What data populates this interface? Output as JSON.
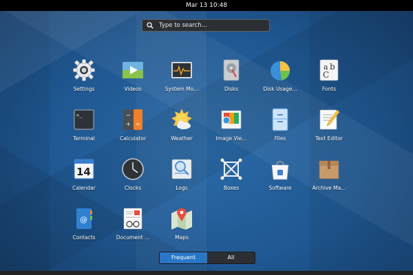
{
  "topbar": {
    "datetime": "Mar 13  10:48"
  },
  "search": {
    "placeholder": "Type to search..."
  },
  "apps": [
    {
      "label": "Settings",
      "icon": "settings-icon"
    },
    {
      "label": "Videos",
      "icon": "videos-icon"
    },
    {
      "label": "System Mo...",
      "icon": "system-monitor-icon"
    },
    {
      "label": "Disks",
      "icon": "disks-icon"
    },
    {
      "label": "Disk Usage...",
      "icon": "disk-usage-icon"
    },
    {
      "label": "Fonts",
      "icon": "fonts-icon"
    },
    {
      "label": "Terminal",
      "icon": "terminal-icon"
    },
    {
      "label": "Calculator",
      "icon": "calculator-icon"
    },
    {
      "label": "Weather",
      "icon": "weather-icon"
    },
    {
      "label": "Image Vie...",
      "icon": "image-viewer-icon"
    },
    {
      "label": "Files",
      "icon": "files-icon"
    },
    {
      "label": "Text Editor",
      "icon": "text-editor-icon"
    },
    {
      "label": "Calendar",
      "icon": "calendar-icon",
      "badge": "14"
    },
    {
      "label": "Clocks",
      "icon": "clocks-icon"
    },
    {
      "label": "Logs",
      "icon": "logs-icon"
    },
    {
      "label": "Boxes",
      "icon": "boxes-icon"
    },
    {
      "label": "Software",
      "icon": "software-icon"
    },
    {
      "label": "Archive Ma...",
      "icon": "archive-manager-icon"
    },
    {
      "label": "Contacts",
      "icon": "contacts-icon"
    },
    {
      "label": "Document ...",
      "icon": "document-viewer-icon"
    },
    {
      "label": "Maps",
      "icon": "maps-icon"
    }
  ],
  "switcher": {
    "frequent": "Frequent",
    "all": "All",
    "active": "frequent"
  },
  "colors": {
    "accent": "#2a76c6",
    "topbar": "#000000",
    "search_bg": "#2b2f33"
  }
}
